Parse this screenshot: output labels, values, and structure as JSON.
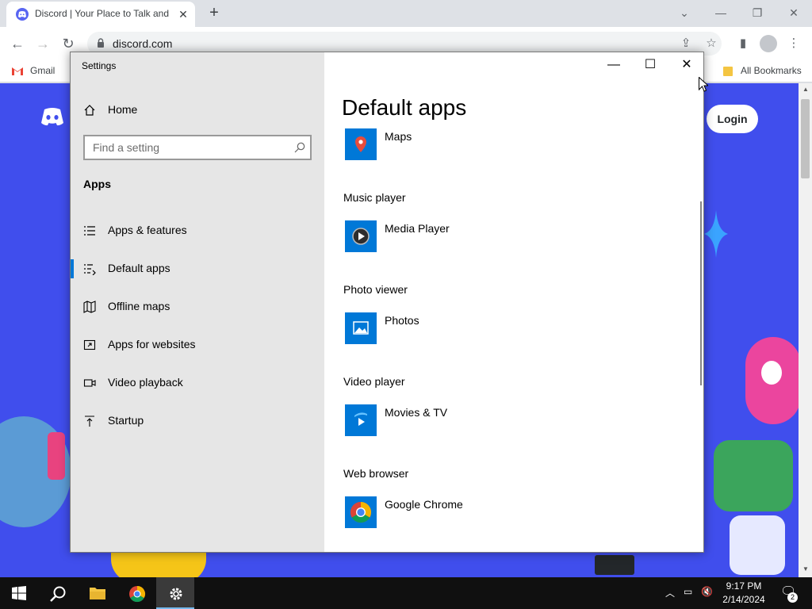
{
  "browser": {
    "tab_title": "Discord | Your Place to Talk and Hang Out",
    "url": "discord.com",
    "bookmarks": {
      "gmail": "Gmail",
      "all": "All Bookmarks"
    }
  },
  "discord": {
    "login_label": "Login"
  },
  "settings": {
    "window_title": "Settings",
    "home_label": "Home",
    "search_placeholder": "Find a setting",
    "section_title": "Apps",
    "nav": [
      {
        "label": "Apps & features",
        "icon": "list-icon"
      },
      {
        "label": "Default apps",
        "icon": "default-apps-icon",
        "active": true
      },
      {
        "label": "Offline maps",
        "icon": "map-icon"
      },
      {
        "label": "Apps for websites",
        "icon": "web-app-icon"
      },
      {
        "label": "Video playback",
        "icon": "video-icon"
      },
      {
        "label": "Startup",
        "icon": "startup-icon"
      }
    ],
    "page_title": "Default apps",
    "defaults": [
      {
        "category": "",
        "app": "Maps",
        "icon": "maps-icon"
      },
      {
        "category": "Music player",
        "app": "Media Player",
        "icon": "media-player-icon"
      },
      {
        "category": "Photo viewer",
        "app": "Photos",
        "icon": "photos-icon"
      },
      {
        "category": "Video player",
        "app": "Movies & TV",
        "icon": "movies-tv-icon"
      },
      {
        "category": "Web browser",
        "app": "Google Chrome",
        "icon": "chrome-icon"
      }
    ]
  },
  "taskbar": {
    "time": "9:17 PM",
    "date": "2/14/2024",
    "notifications": "2"
  },
  "colors": {
    "accent": "#0078d7",
    "discord": "#404eed",
    "taskbar": "#101010"
  }
}
